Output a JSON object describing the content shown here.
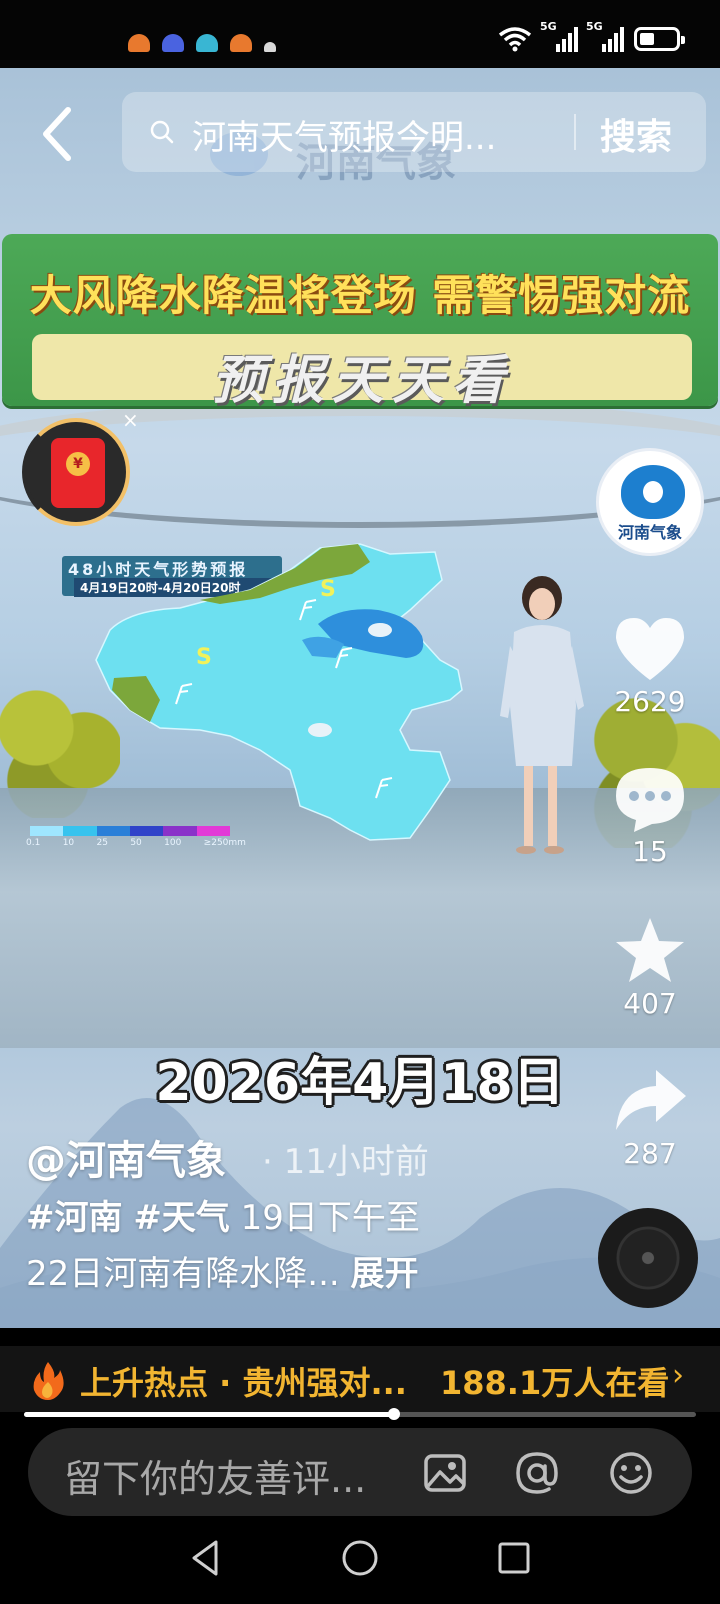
{
  "status_bar": {
    "network_1": "5G",
    "network_2": "5G",
    "notif_colors": [
      "#e8792e",
      "#4a63e0",
      "#39b6d3",
      "#e8792e",
      "#d9d9d9"
    ]
  },
  "search": {
    "query": "河南天气预报今明...",
    "button": "搜索"
  },
  "watermark": "河南气象",
  "banner": {
    "title": "大风降水降温将登场 需警惕强对流",
    "subtitle": "预报天天看"
  },
  "redpacket": {
    "coin": "¥",
    "close": "×"
  },
  "map": {
    "legend_title": "48小时天气形势预报",
    "legend_date": "4月19日20时-4月20日20时",
    "scale_labels": [
      "0.1",
      "10",
      "25",
      "50",
      "100",
      "≥250mm"
    ],
    "scale_colors": [
      "#9fe6ff",
      "#37c3ee",
      "#2a7fd8",
      "#3043c9",
      "#8a32c9",
      "#e23ad7"
    ],
    "region_colors": {
      "rain": "#6de0f0",
      "heavy": "#2e8fdc",
      "dry": "#7ca73b"
    },
    "symbols": [
      "S",
      "S"
    ]
  },
  "account": {
    "avatar_label": "河南气象",
    "handle": "@河南气象",
    "time_ago": "· 11小时前"
  },
  "actions": {
    "likes": "2629",
    "comments": "15",
    "favorites": "407",
    "shares": "287"
  },
  "date_stamp": "2026年4月18日",
  "caption": {
    "tag1": "#河南",
    "tag2": "#天气",
    "text_line1": "19日下午至",
    "text_line2": "22日河南有降水降...",
    "expand": "展开"
  },
  "hot": {
    "topic": "上升热点 · 贵州强对...",
    "viewers": "188.1万人在看",
    "arrow": "›"
  },
  "playback": {
    "progress": 0.55
  },
  "comment_bar": {
    "placeholder": "留下你的友善评..."
  },
  "colors": {
    "hot_text": "#f2b531",
    "banner_green": "#4da957",
    "banner_title": "#ffe15a"
  }
}
